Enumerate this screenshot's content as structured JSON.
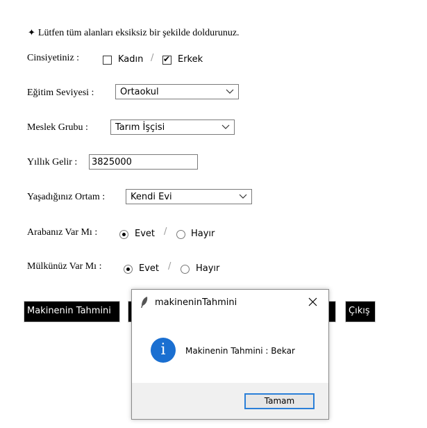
{
  "form": {
    "intro_icon": "four-point-star-icon",
    "intro": "Lütfen tüm alanları eksiksiz bir şekilde doldurunuz.",
    "gender": {
      "label": "Cinsiyetiniz :",
      "options": [
        "Kadın",
        "Erkek"
      ],
      "checked": "Erkek",
      "separator": "/"
    },
    "education": {
      "label": "Eğitim Seviyesi :",
      "value": "Ortaokul"
    },
    "occupation": {
      "label": "Meslek Grubu :",
      "value": "Tarım İşçisi"
    },
    "income": {
      "label": "Yıllık Gelir :",
      "value": "3825000"
    },
    "living": {
      "label": "Yaşadığınız Ortam :",
      "value": "Kendi Evi"
    },
    "car": {
      "label": "Arabanız Var Mı :",
      "options": [
        "Evet",
        "Hayır"
      ],
      "selected": "Evet",
      "separator": "/"
    },
    "property": {
      "label": "Mülkünüz Var Mı :",
      "options": [
        "Evet",
        "Hayır"
      ],
      "selected": "Evet",
      "separator": "/"
    },
    "buttons": {
      "predict": "Makinenin Tahmini",
      "exit": "Çıkış"
    }
  },
  "dialog": {
    "title": "makineninTahmini",
    "icon": "info-icon",
    "message": "Makinenin Tahmini : Bekar",
    "ok": "Tamam"
  },
  "colors": {
    "info_blue": "#1a6fd1",
    "focus_blue": "#2a7fd8"
  }
}
